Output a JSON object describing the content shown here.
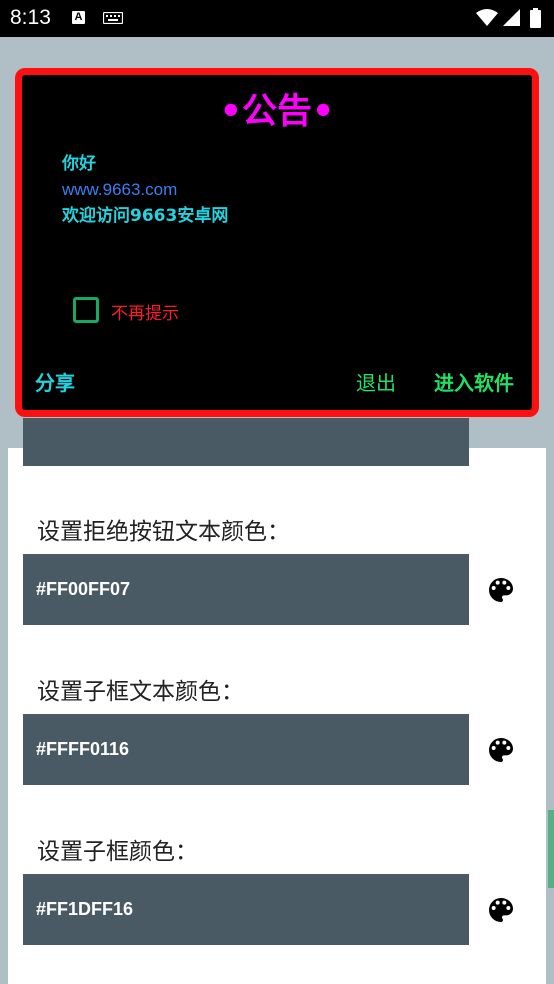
{
  "status_bar": {
    "time": "8:13",
    "a_icon_letter": "A"
  },
  "settings": {
    "items": [
      {
        "label": "设置拒绝按钮文本颜色：",
        "value": "#FF00FF07"
      },
      {
        "label": "设置子框文本颜色：",
        "value": "#FFFF0116"
      },
      {
        "label": "设置子框颜色：",
        "value": "#FF1DFF16"
      }
    ]
  },
  "dialog": {
    "title": "•公告•",
    "message_lines": [
      "你好",
      "www.9663.com",
      "欢迎访问9663安卓网"
    ],
    "checkbox_label": "不再提示",
    "share_label": "分享",
    "exit_label": "退出",
    "enter_label": "进入软件"
  },
  "colors": {
    "dialog_border": "#ff1010",
    "title": "#ff00ff",
    "text_cyan": "#22d3e0",
    "link_blue": "#3a7ff0",
    "check_green": "#16a865",
    "hint_red": "#ff1a2a",
    "button_green": "#22e060",
    "field_bg": "#4a5a65"
  }
}
